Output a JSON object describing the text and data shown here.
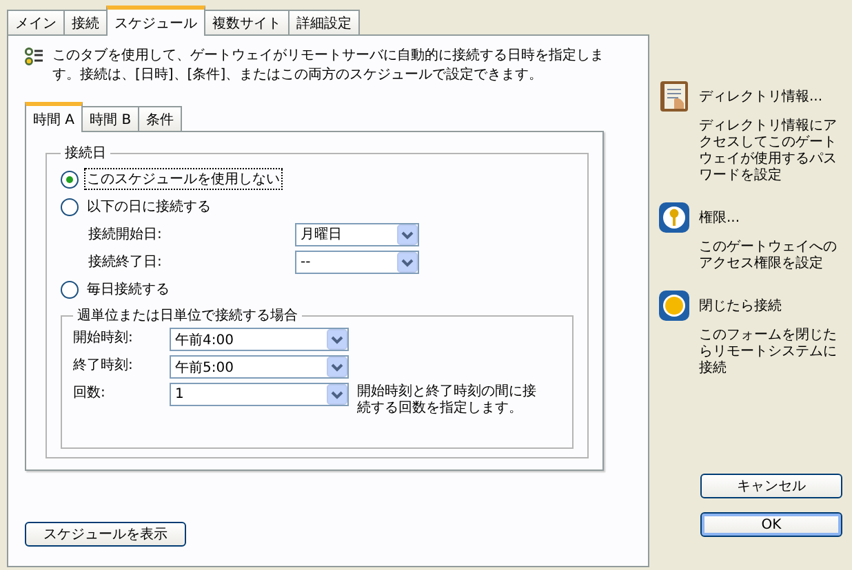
{
  "tabs": [
    {
      "label": "メイン",
      "selected": false
    },
    {
      "label": "接続",
      "selected": false
    },
    {
      "label": "スケジュール",
      "selected": true
    },
    {
      "label": "複数サイト",
      "selected": false
    },
    {
      "label": "詳細設定",
      "selected": false
    }
  ],
  "description": "このタブを使用して、ゲートウェイがリモートサーバに自動的に接続する日時を指定します。接続は、[日時]、[条件]、またはこの両方のスケジュールで設定できます。",
  "subtabs": [
    {
      "label": "時間 A",
      "selected": true
    },
    {
      "label": "時間 B",
      "selected": false
    },
    {
      "label": "条件",
      "selected": false
    }
  ],
  "connect_day": {
    "title": "接続日",
    "items": [
      {
        "kind": "radio",
        "label": "このスケジュールを使用しない",
        "selected": true,
        "focused": true
      },
      {
        "kind": "radio",
        "label": "以下の日に接続する",
        "selected": false,
        "focused": false
      },
      {
        "kind": "field",
        "label": "接続開始日:",
        "value": "月曜日"
      },
      {
        "kind": "field",
        "label": "接続終了日:",
        "value": "--"
      },
      {
        "kind": "radio",
        "label": "毎日接続する",
        "selected": false,
        "focused": false
      }
    ]
  },
  "period": {
    "title": "週単位または日単位で接続する場合",
    "rows": [
      {
        "label": "開始時刻:",
        "value": "午前4:00"
      },
      {
        "label": "終了時刻:",
        "value": "午前5:00"
      },
      {
        "label": "回数:",
        "value": "1",
        "hint": "開始時刻と終了時刻の間に接続する回数を指定します。"
      }
    ]
  },
  "show_schedule_button": "スケジュールを表示",
  "actions": [
    {
      "kind": "book",
      "title": "ディレクトリ情報...",
      "description": "ディレクトリ情報にアクセスしてこのゲートウェイが使用するパスワードを設定"
    },
    {
      "kind": "key",
      "title": "権限...",
      "description": "このゲートウェイへのアクセス権限を設定"
    },
    {
      "kind": "dot",
      "title": "閉じたら接続",
      "description": "このフォームを閉じたらリモートシステムに接続"
    }
  ],
  "buttons": [
    {
      "label": "キャンセル",
      "default": false
    },
    {
      "label": "OK",
      "default": true
    }
  ]
}
